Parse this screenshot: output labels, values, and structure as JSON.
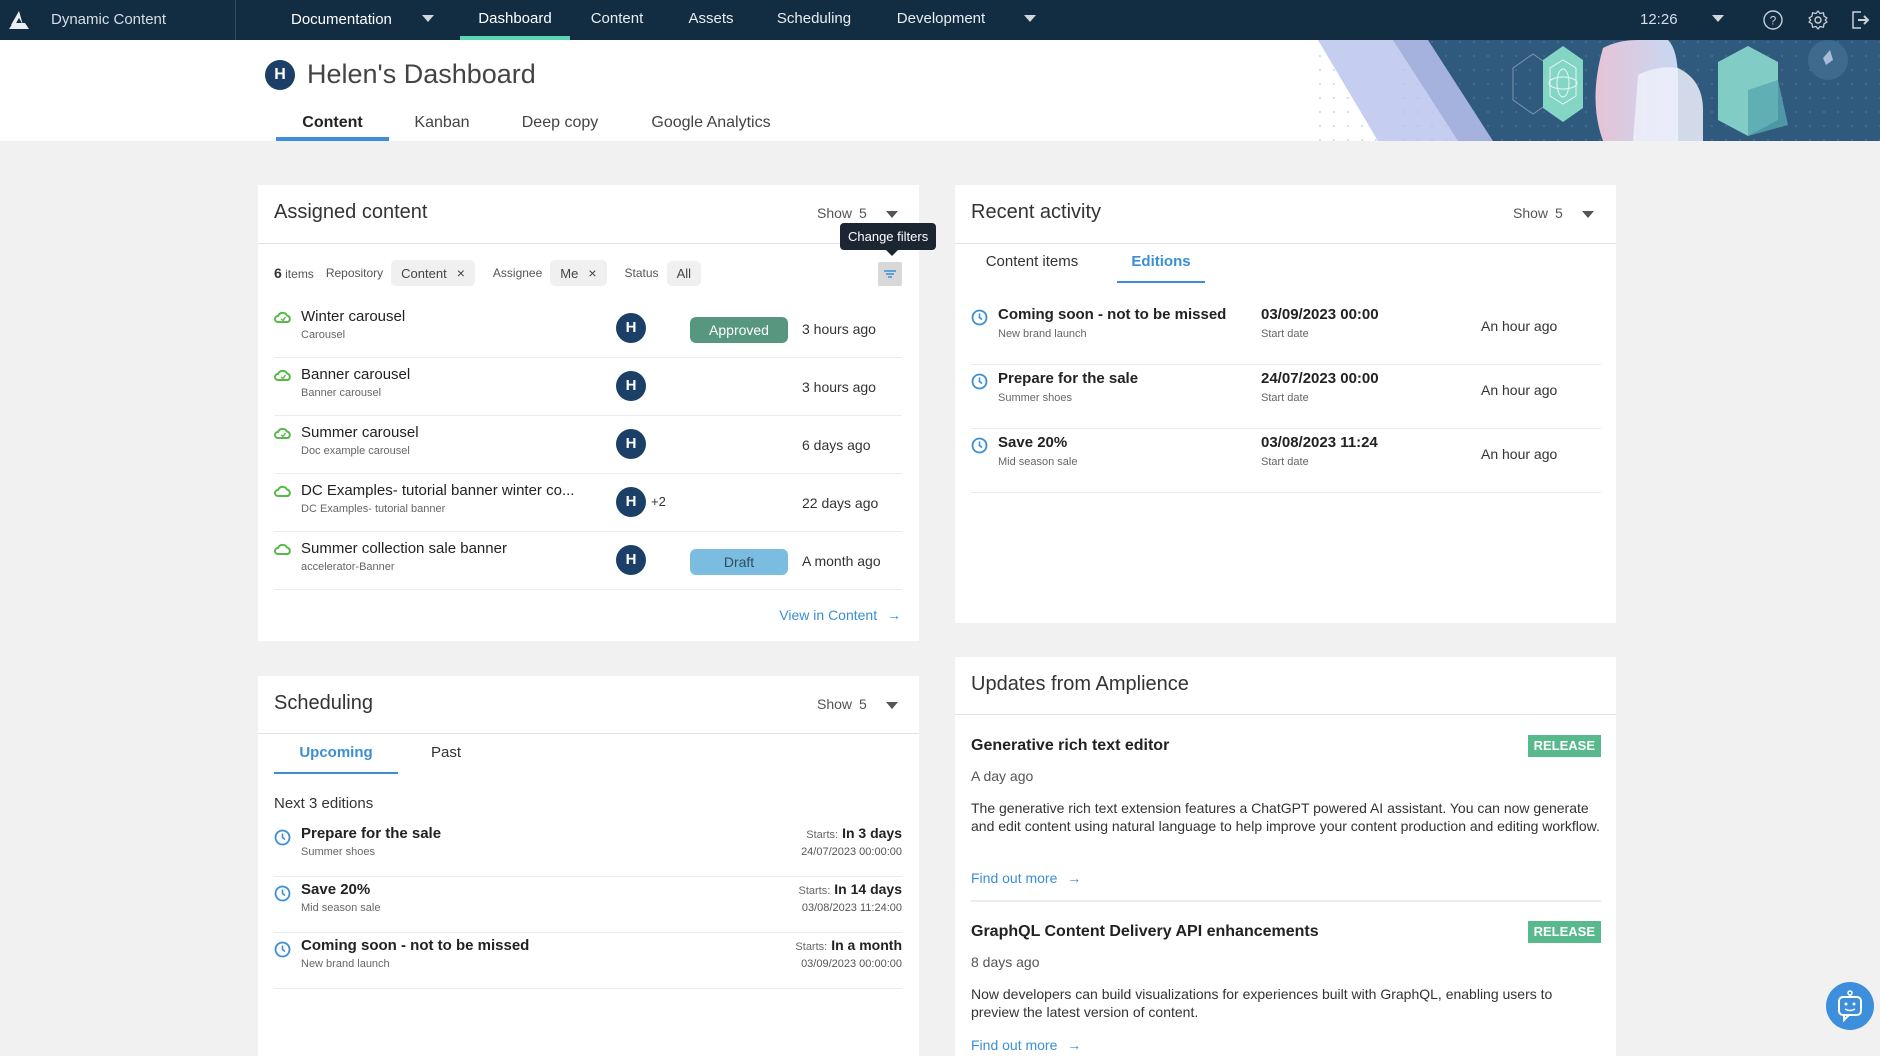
{
  "topnav": {
    "app_name": "Dynamic Content",
    "hub": "Documentation",
    "items": [
      {
        "label": "Dashboard",
        "active": true
      },
      {
        "label": "Content"
      },
      {
        "label": "Assets"
      },
      {
        "label": "Scheduling"
      },
      {
        "label": "Development"
      }
    ],
    "time": "12:26",
    "icons": [
      "help-icon",
      "settings-icon",
      "logout-icon"
    ]
  },
  "header": {
    "avatar_initial": "H",
    "title": "Helen's Dashboard",
    "tabs": [
      {
        "label": "Content",
        "active": true
      },
      {
        "label": "Kanban"
      },
      {
        "label": "Deep copy"
      },
      {
        "label": "Google Analytics"
      }
    ]
  },
  "assigned": {
    "title": "Assigned content",
    "show_label": "Show",
    "show_value": "5",
    "count": "6",
    "count_label": "items",
    "filters": {
      "repository_label": "Repository",
      "repository_value": "Content",
      "assignee_label": "Assignee",
      "assignee_value": "Me",
      "status_label": "Status",
      "status_value": "All"
    },
    "tooltip": "Change filters",
    "rows": [
      {
        "name": "Winter carousel",
        "type": "Carousel",
        "avatar": "H",
        "extra": "",
        "status": "Approved",
        "when": "3 hours ago"
      },
      {
        "name": "Banner carousel",
        "type": "Banner carousel",
        "avatar": "H",
        "extra": "",
        "status": "",
        "when": "3 hours ago"
      },
      {
        "name": "Summer carousel",
        "type": "Doc example carousel",
        "avatar": "H",
        "extra": "",
        "status": "",
        "when": "6 days ago"
      },
      {
        "name": "DC Examples- tutorial banner winter co...",
        "type": "DC Examples- tutorial banner",
        "avatar": "H",
        "extra": "+2",
        "status": "",
        "when": "22 days ago"
      },
      {
        "name": "Summer collection sale banner",
        "type": "accelerator-Banner",
        "avatar": "H",
        "extra": "",
        "status": "Draft",
        "when": "A month ago"
      }
    ],
    "view_link": "View in Content"
  },
  "recent": {
    "title": "Recent activity",
    "show_label": "Show",
    "show_value": "5",
    "tabs": [
      {
        "label": "Content items"
      },
      {
        "label": "Editions",
        "active": true
      }
    ],
    "rows": [
      {
        "name": "Coming soon - not to be missed",
        "sub": "New brand launch",
        "date": "03/09/2023 00:00",
        "date_label": "Start date",
        "when": "An hour ago"
      },
      {
        "name": "Prepare for the sale",
        "sub": "Summer shoes",
        "date": "24/07/2023 00:00",
        "date_label": "Start date",
        "when": "An hour ago"
      },
      {
        "name": "Save 20%",
        "sub": "Mid season sale",
        "date": "03/08/2023 11:24",
        "date_label": "Start date",
        "when": "An hour ago"
      }
    ]
  },
  "scheduling": {
    "title": "Scheduling",
    "show_label": "Show",
    "show_value": "5",
    "tabs": [
      {
        "label": "Upcoming",
        "active": true
      },
      {
        "label": "Past"
      }
    ],
    "next_label": "Next 3 editions",
    "starts_label": "Starts:",
    "rows": [
      {
        "name": "Prepare for the sale",
        "sub": "Summer shoes",
        "starts": "In 3 days",
        "full": "24/07/2023 00:00:00"
      },
      {
        "name": "Save 20%",
        "sub": "Mid season sale",
        "starts": "In 14 days",
        "full": "03/08/2023 11:24:00"
      },
      {
        "name": "Coming soon - not to be missed",
        "sub": "New brand launch",
        "starts": "In a month",
        "full": "03/09/2023 00:00:00"
      }
    ]
  },
  "updates": {
    "title": "Updates from Amplience",
    "items": [
      {
        "title": "Generative rich text editor",
        "badge": "RELEASE",
        "when": "A day ago",
        "desc": "The generative rich text extension features a ChatGPT powered AI assistant. You can now generate and edit content using natural language to help improve your content production and editing workflow.",
        "link": "Find out more"
      },
      {
        "title": "GraphQL Content Delivery API enhancements",
        "badge": "RELEASE",
        "when": "8 days ago",
        "desc": "Now developers can build visualizations for experiences built with GraphQL, enabling users to preview the latest version of content.",
        "link": "Find out more"
      }
    ]
  },
  "colors": {
    "nav_bg": "#122c42",
    "accent": "#3a8fd5",
    "nav_active": "#5cd6b2",
    "approved": "#58977f",
    "draft": "#7bbde0",
    "release": "#58b98d"
  }
}
